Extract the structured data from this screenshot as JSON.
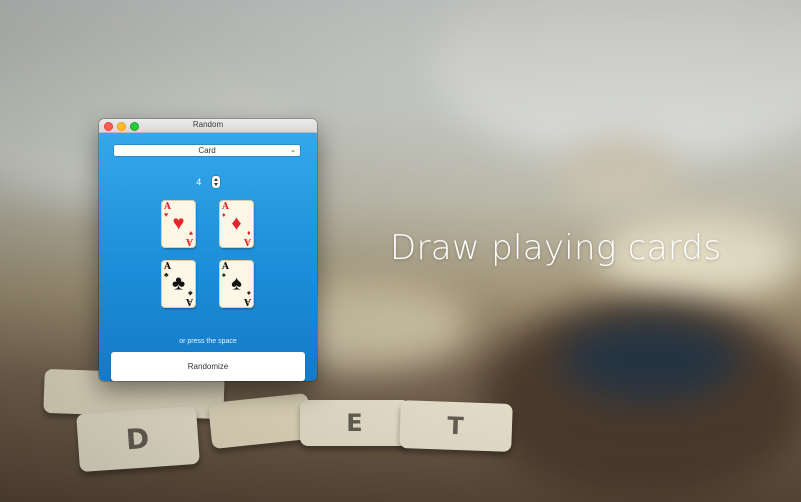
{
  "headline": "Draw playing cards",
  "window": {
    "title": "Random",
    "controls": [
      "close",
      "minimize",
      "zoom"
    ],
    "mode_select": {
      "value": "Card",
      "icon": "chevron-down-icon"
    },
    "count": {
      "value": "4"
    },
    "cards": [
      {
        "rank": "A",
        "suit": "♥",
        "suit_name": "hearts",
        "color": "#e3242b"
      },
      {
        "rank": "A",
        "suit": "♦",
        "suit_name": "diamonds",
        "color": "#e3242b"
      },
      {
        "rank": "A",
        "suit": "♣",
        "suit_name": "clubs",
        "color": "#111111"
      },
      {
        "rank": "A",
        "suit": "♠",
        "suit_name": "spades",
        "color": "#111111"
      }
    ],
    "hint": "or press the space",
    "randomize_label": "Randomize"
  },
  "background_tiles": [
    {
      "letter": "D"
    },
    {
      "letter": "E"
    },
    {
      "letter": "T"
    }
  ]
}
